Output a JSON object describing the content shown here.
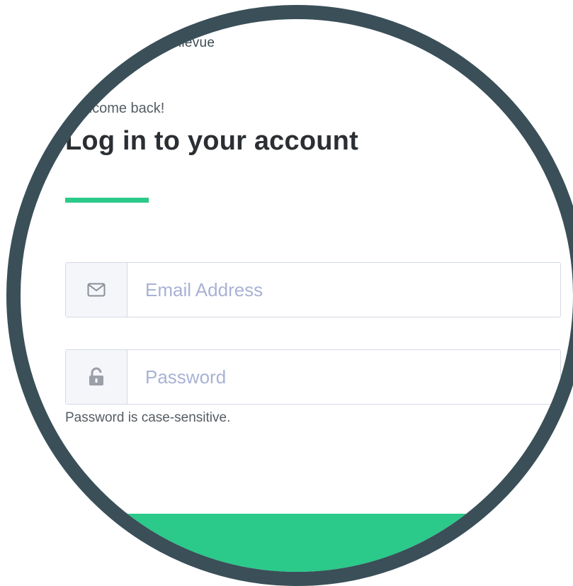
{
  "brand": {
    "line1": "Bellevue",
    "line2": "Bellevue"
  },
  "header": {
    "welcome": "Welcome back!",
    "title": "Log in to your account"
  },
  "form": {
    "email": {
      "placeholder": "Email Address",
      "value": "",
      "icon": "envelope-icon"
    },
    "password": {
      "placeholder": "Password",
      "value": "",
      "icon": "unlock-icon"
    },
    "password_hint": "Password is case-sensitive."
  },
  "submit": {
    "label": ""
  },
  "colors": {
    "accent": "#2bc98a",
    "frame": "#3a4f58",
    "placeholder": "#a9b2d4",
    "title": "#2b2f33"
  }
}
